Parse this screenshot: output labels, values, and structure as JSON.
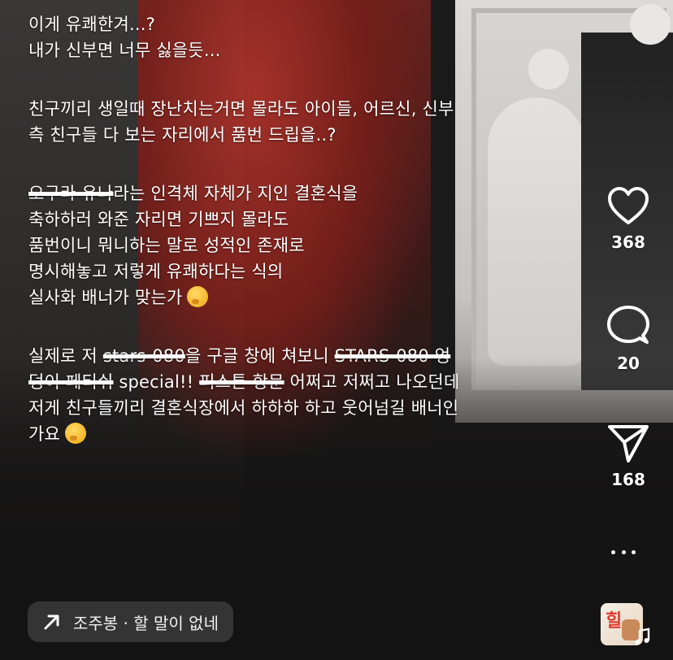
{
  "post": {
    "caption_lines": [
      "이게 유쾌한겨...?",
      "내가 신부면 너무 싫을듯...",
      "",
      "친구끼리 생일때 장난치는거면 몰라도 아이들, 어르신, 신부",
      "측 친구들 다 보는 자리에서 품번 드립을..?",
      "",
      "라는 인격체 자체가 지인 결혼식을",
      "축하하러 와준 자리면 기쁘지 몰라도",
      "품번이니 뭐니하는 말로 성적인 존재로",
      "명시해놓고 저렇게 유쾌하다는 식의",
      "실사화 배너가 맞는가",
      "",
      "실제로 저 ",
      "을 구글 창에 쳐보니 ",
      " special!! ",
      " 어쩌고 저쩌고 나오던데",
      "저게 친구들끼리 결혼식장에서 하하하 하고 웃어넘길 배너인",
      "가요"
    ],
    "strikes": {
      "name": "오구라 유나",
      "stars": "stars-080",
      "search_result": "STARS-080 엉",
      "search_result_2": "덩이 페티쉬",
      "hangmun": "피스톤 항문"
    }
  },
  "actions": {
    "like": {
      "icon": "heart-icon",
      "count": "368"
    },
    "comment": {
      "icon": "comment-bubble-icon",
      "count": "20"
    },
    "share": {
      "icon": "send-icon",
      "count": "168"
    },
    "more": {
      "icon": "more-dots-icon"
    }
  },
  "footer": {
    "reply_chip": "조주봉 · 할 말이 없네",
    "reply_icon": "arrow-up-right-icon",
    "music_icon": "music-note-icon"
  },
  "colors": {
    "text": "#ffffff",
    "chip_bg": "#505050",
    "background": "#1b1a1a"
  }
}
